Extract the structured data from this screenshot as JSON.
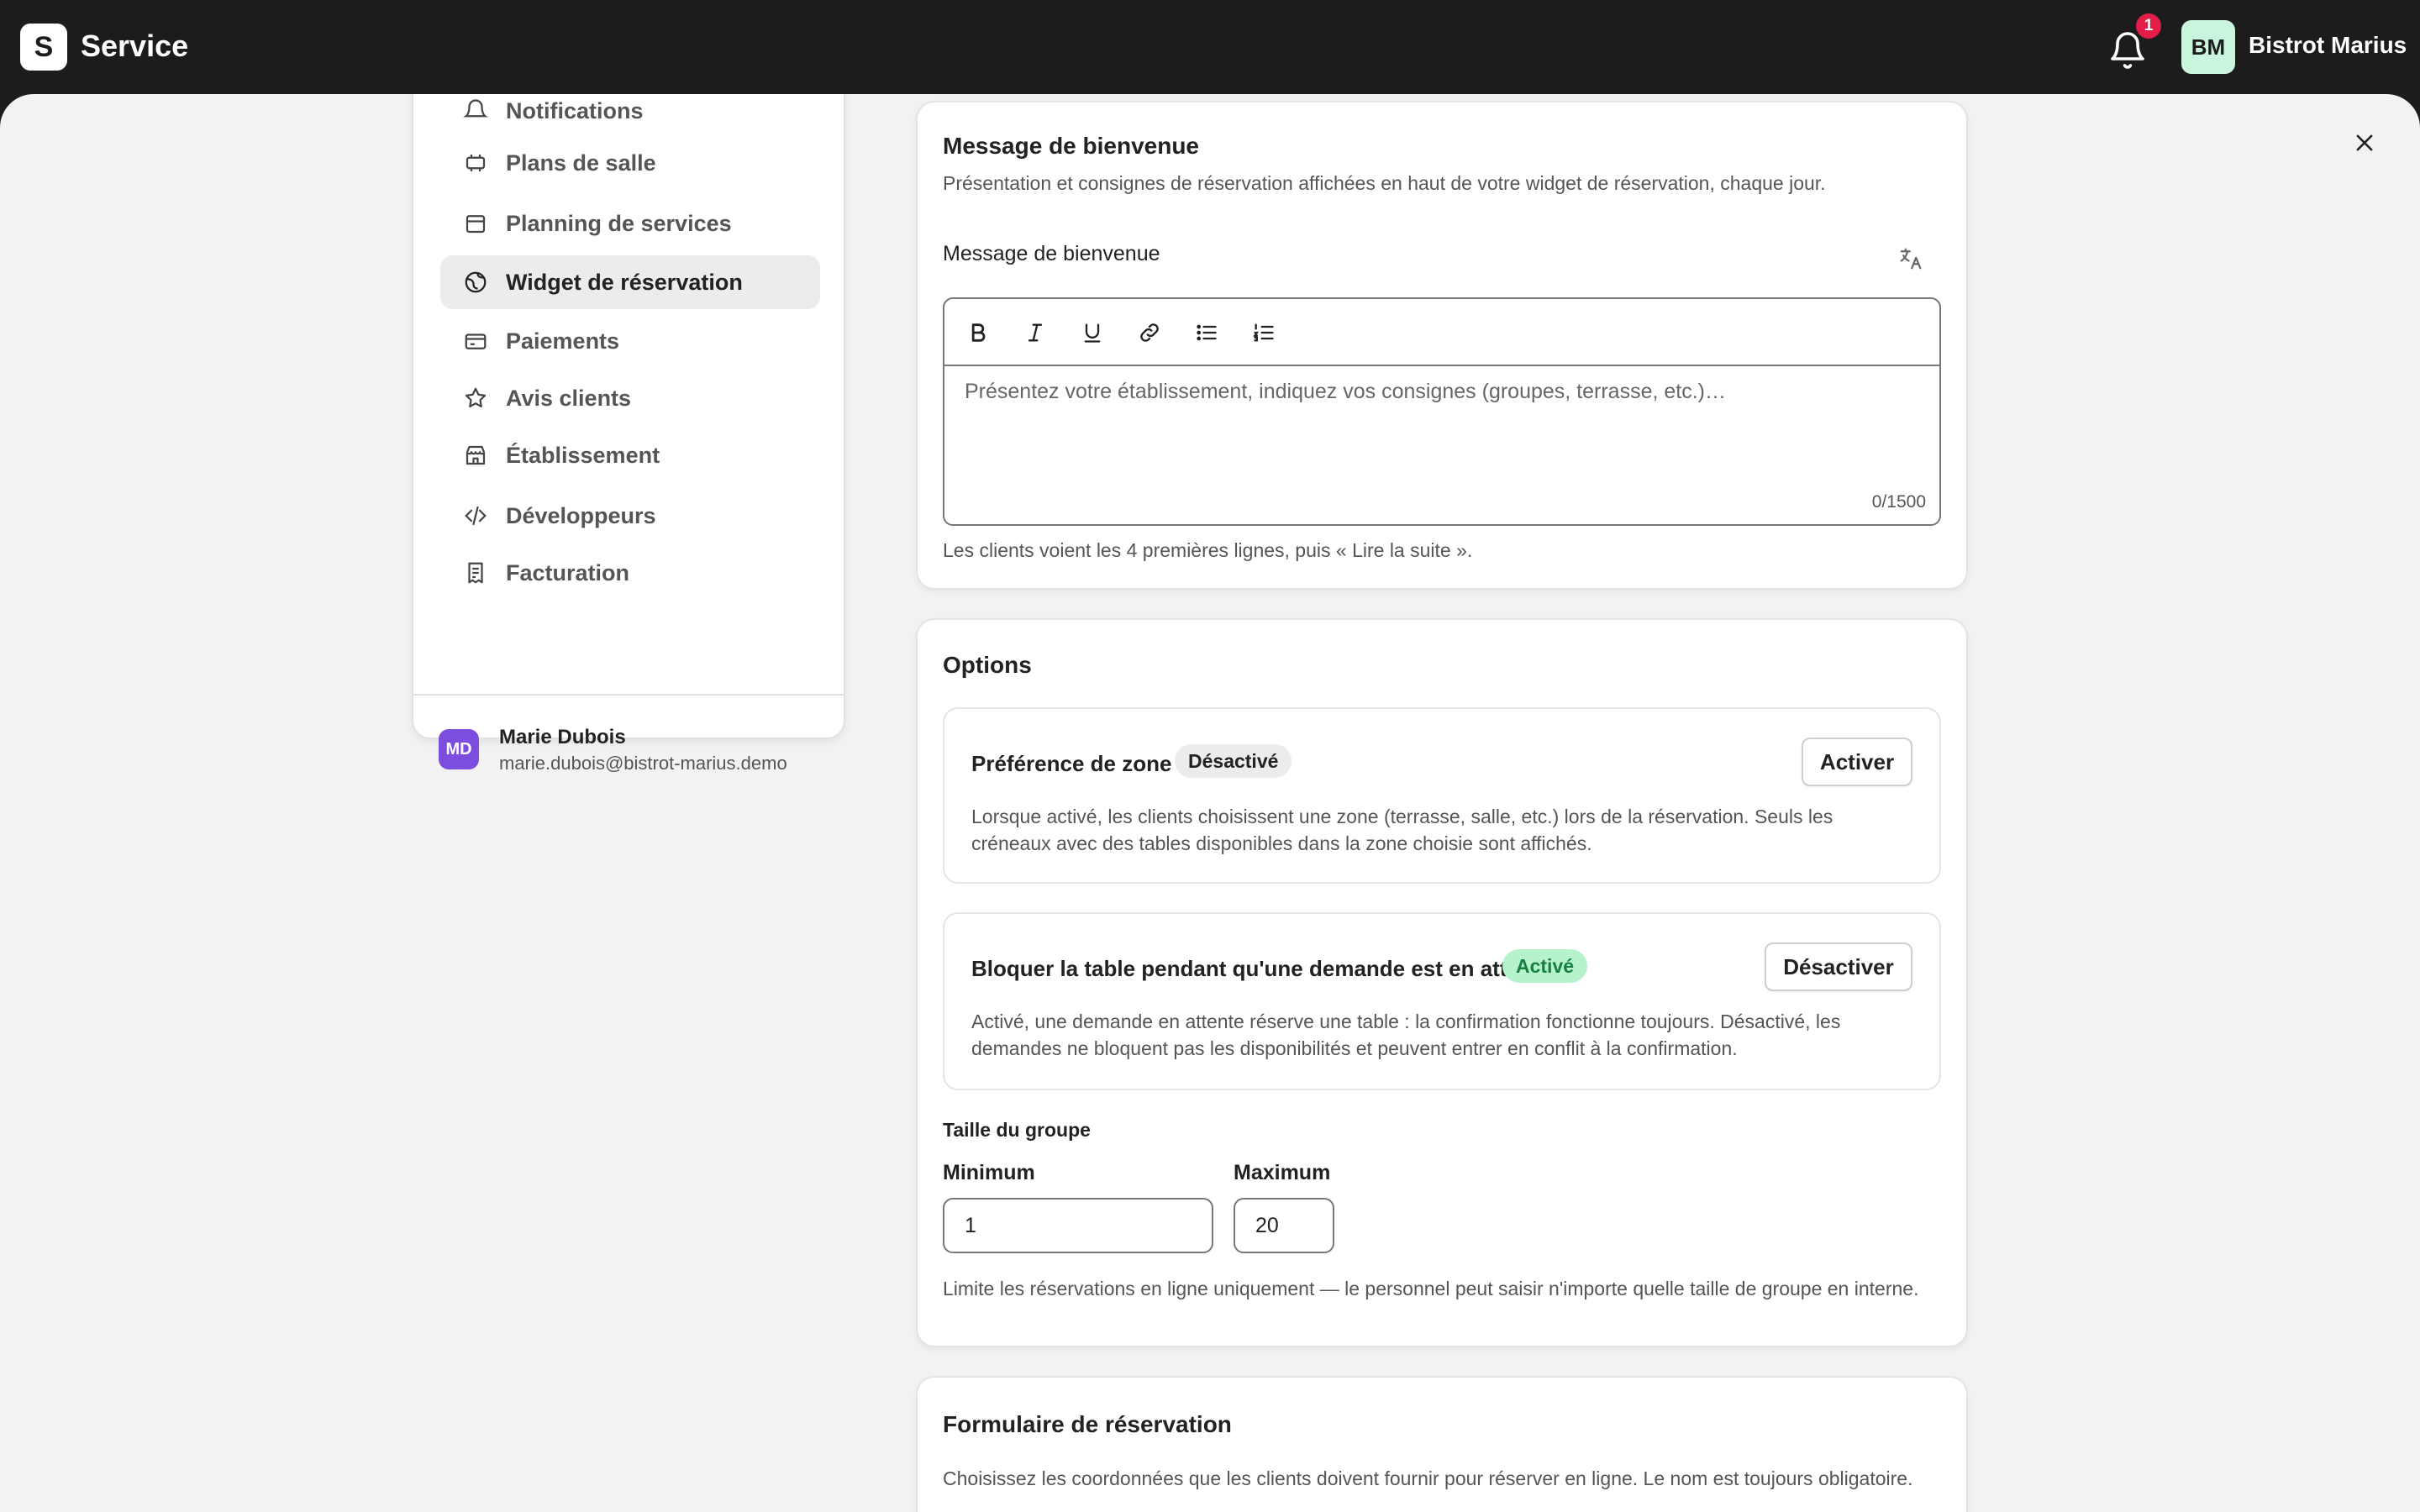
{
  "app": {
    "logo_letter": "S",
    "title": "Service"
  },
  "header": {
    "notification_count": "1",
    "org_initials": "BM",
    "org_name": "Bistrot Marius"
  },
  "sidebar": {
    "items": [
      {
        "label": "Notifications",
        "icon": "bell-icon"
      },
      {
        "label": "Plans de salle",
        "icon": "table-icon"
      },
      {
        "label": "Planning de services",
        "icon": "calendar-icon"
      },
      {
        "label": "Widget de réservation",
        "icon": "globe-icon",
        "active": true
      },
      {
        "label": "Paiements",
        "icon": "credit-card-icon"
      },
      {
        "label": "Avis clients",
        "icon": "star-icon"
      },
      {
        "label": "Établissement",
        "icon": "store-icon"
      },
      {
        "label": "Développeurs",
        "icon": "code-icon"
      },
      {
        "label": "Facturation",
        "icon": "receipt-icon"
      }
    ],
    "user": {
      "initials": "MD",
      "name": "Marie Dubois",
      "email": "marie.dubois@bistrot-marius.demo"
    }
  },
  "welcome": {
    "title": "Message de bienvenue",
    "description": "Présentation et consignes de réservation affichées en haut de votre widget de réservation, chaque jour.",
    "field_label": "Message de bienvenue",
    "placeholder": "Présentez votre établissement, indiquez vos consignes (groupes, terrasse, etc.)…",
    "char_count": "0/1500",
    "help": "Les clients voient les 4 premières lignes, puis « Lire la suite »."
  },
  "options": {
    "title": "Options",
    "zone": {
      "title": "Préférence de zone",
      "status": "Désactivé",
      "button": "Activer",
      "description": "Lorsque activé, les clients choisissent une zone (terrasse, salle, etc.) lors de la réservation. Seuls les créneaux avec des tables disponibles dans la zone choisie sont affichés."
    },
    "block": {
      "title": "Bloquer la table pendant qu'une demande est en attente",
      "status": "Activé",
      "button": "Désactiver",
      "description": "Activé, une demande en attente réserve une table : la confirmation fonctionne toujours. Désactivé, les demandes ne bloquent pas les disponibilités et peuvent entrer en conflit à la confirmation."
    },
    "group": {
      "label": "Taille du groupe",
      "min_label": "Minimum",
      "min_value": "1",
      "max_label": "Maximum",
      "max_value": "20",
      "help": "Limite les réservations en ligne uniquement — le personnel peut saisir n'importe quelle taille de groupe en interne."
    }
  },
  "form": {
    "title": "Formulaire de réservation",
    "description": "Choisissez les coordonnées que les clients doivent fournir pour réserver en ligne. Le nom est toujours obligatoire."
  },
  "colors": {
    "topbar": "#1c1c1c",
    "active_badge": "#b6f2cc",
    "notification_badge": "#e11d48",
    "user_avatar": "#7c4dde",
    "org_avatar": "#c9f5dc"
  }
}
